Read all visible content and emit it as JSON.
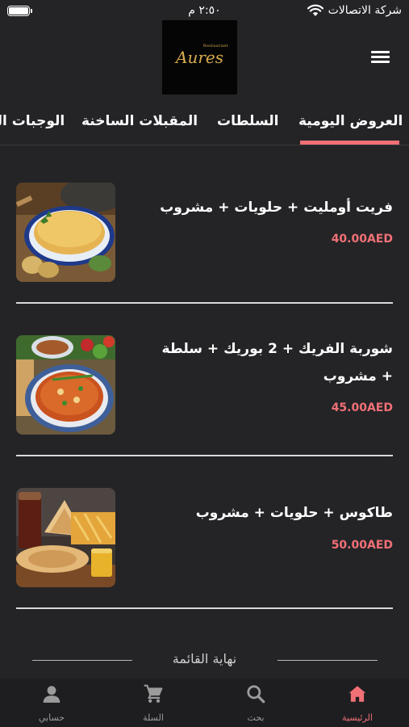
{
  "status_bar": {
    "carrier": "شركة الاتصالات",
    "time": "٢:٥٠ م",
    "battery_level": 1.0
  },
  "header": {
    "logo_text": "Aures",
    "logo_subtext": "Restaurant",
    "menu_icon": "hamburger-menu-icon"
  },
  "tabs": {
    "items": [
      {
        "label": "العروض اليومية",
        "active": true
      },
      {
        "label": "السلطات",
        "active": false
      },
      {
        "label": "المقبلات الساخنة",
        "active": false
      },
      {
        "label": "الوجبات الر",
        "active": false
      }
    ],
    "accent_color": "#f07076"
  },
  "menu_items": [
    {
      "title": "فريت أومليت + حلويات + مشروب",
      "price": "40.00AED",
      "image": "spanish-omelette-photo"
    },
    {
      "title": "شوربة الفريك + 2 بوريك + سلطة + مشروب",
      "price": "45.00AED",
      "image": "frik-soup-photo"
    },
    {
      "title": "طاكوس + حلويات + مشروب",
      "price": "50.00AED",
      "image": "tacos-fries-photo"
    }
  ],
  "end_of_list": "نهاية القائمة",
  "bottom_nav": {
    "items": [
      {
        "label": "الرئيسية",
        "icon": "home-icon",
        "active": true
      },
      {
        "label": "بحث",
        "icon": "search-icon",
        "active": false
      },
      {
        "label": "السلة",
        "icon": "cart-icon",
        "active": false
      },
      {
        "label": "حسابي",
        "icon": "user-icon",
        "active": false
      }
    ]
  },
  "colors": {
    "background": "#242427",
    "accent": "#f07076",
    "logo_gold": "#d8ac4e"
  }
}
